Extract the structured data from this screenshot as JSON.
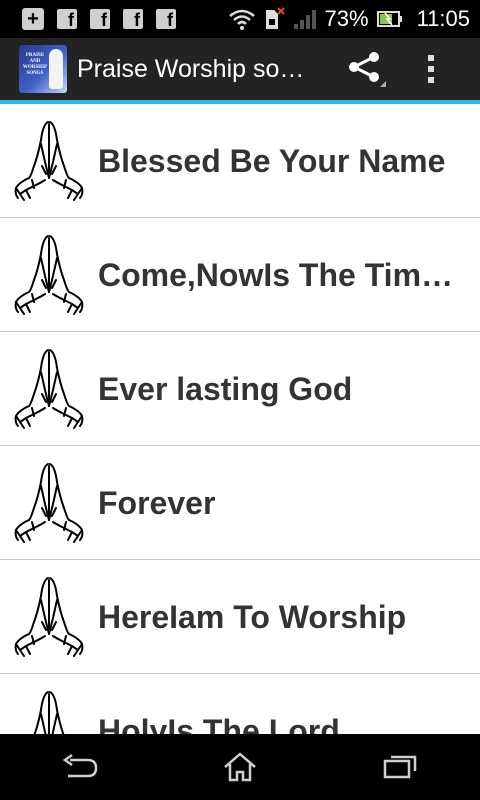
{
  "status_bar": {
    "notifications": [
      "plus-icon",
      "facebook-icon",
      "facebook-icon",
      "facebook-icon",
      "facebook-icon"
    ],
    "battery_text": "73%",
    "time": "11:05"
  },
  "action_bar": {
    "logo_text": "PRAISE AND WORSHIP SONGS",
    "title": "Praise Worship so…",
    "accent_color": "#33b5e5"
  },
  "songs": [
    {
      "title": "Blessed Be Your Name"
    },
    {
      "title": "Come,NowIs The Tim…"
    },
    {
      "title": "Ever lasting God"
    },
    {
      "title": "Forever"
    },
    {
      "title": "HereIam To Worship"
    },
    {
      "title": "HolyIs The Lord"
    }
  ]
}
